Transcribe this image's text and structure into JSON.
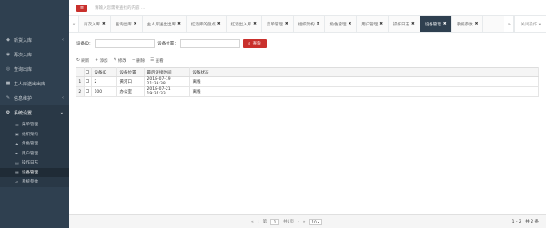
{
  "topbar": {
    "menu_icon": "bars-icon",
    "search_hint": "请输入您需要查找的内容 …"
  },
  "tabs": {
    "left_icon": "«",
    "items": [
      {
        "label": "再次入库"
      },
      {
        "label": "查询出库"
      },
      {
        "label": "主人库送出出库"
      },
      {
        "label": "红酒库的盘点"
      },
      {
        "label": "红酒出入库"
      },
      {
        "label": "菜单管理"
      },
      {
        "label": "组织架构"
      },
      {
        "label": "角色管理"
      },
      {
        "label": "用户管理"
      },
      {
        "label": "操作日志"
      },
      {
        "label": "设备管理",
        "active": true
      },
      {
        "label": "系统参数"
      }
    ],
    "right_icon": "»",
    "right_text": "关闭操作 ▾"
  },
  "sidebar": {
    "items": [
      {
        "label": "新货入库",
        "icon": "◆"
      },
      {
        "label": "再次入库",
        "icon": "◉"
      },
      {
        "label": "查询出库",
        "icon": "◎"
      },
      {
        "label": "主人库送出出库",
        "icon": "■"
      },
      {
        "label": "信息维护",
        "icon": "✎"
      },
      {
        "label": "系统设置",
        "icon": "⚙"
      }
    ],
    "sub_items": [
      {
        "label": "菜单管理",
        "icon": "☰"
      },
      {
        "label": "组织架构",
        "icon": "▣"
      },
      {
        "label": "角色管理",
        "icon": "♟"
      },
      {
        "label": "用户管理",
        "icon": "▪"
      },
      {
        "label": "操作日志",
        "icon": "▤"
      },
      {
        "label": "设备管理",
        "icon": "▦"
      },
      {
        "label": "系统参数",
        "icon": "✐"
      }
    ]
  },
  "search": {
    "id_label": "设备ID：",
    "id_value": "",
    "pos_label": "设备位置：",
    "pos_value": "",
    "query_label": "查询"
  },
  "toolbar": {
    "refresh": "刷新",
    "add": "添加",
    "edit": "修改",
    "delete": "删除",
    "view": "查看"
  },
  "table": {
    "columns": [
      "设备ID",
      "设备位置",
      "最后连接时间",
      "设备状态"
    ],
    "rows": [
      [
        "2",
        "黄河口",
        "2018-07-19 21:33:38",
        "离线"
      ],
      [
        "100",
        "办公室",
        "2018-07-21 19:37:33",
        "离线"
      ]
    ]
  },
  "pager": {
    "first": "«",
    "prev": "‹",
    "page_text": "第",
    "page_value": "1",
    "of_text": "共1页",
    "next": "›",
    "last": "»",
    "size": "10",
    "summary": "1 - 2　共 2 条"
  }
}
